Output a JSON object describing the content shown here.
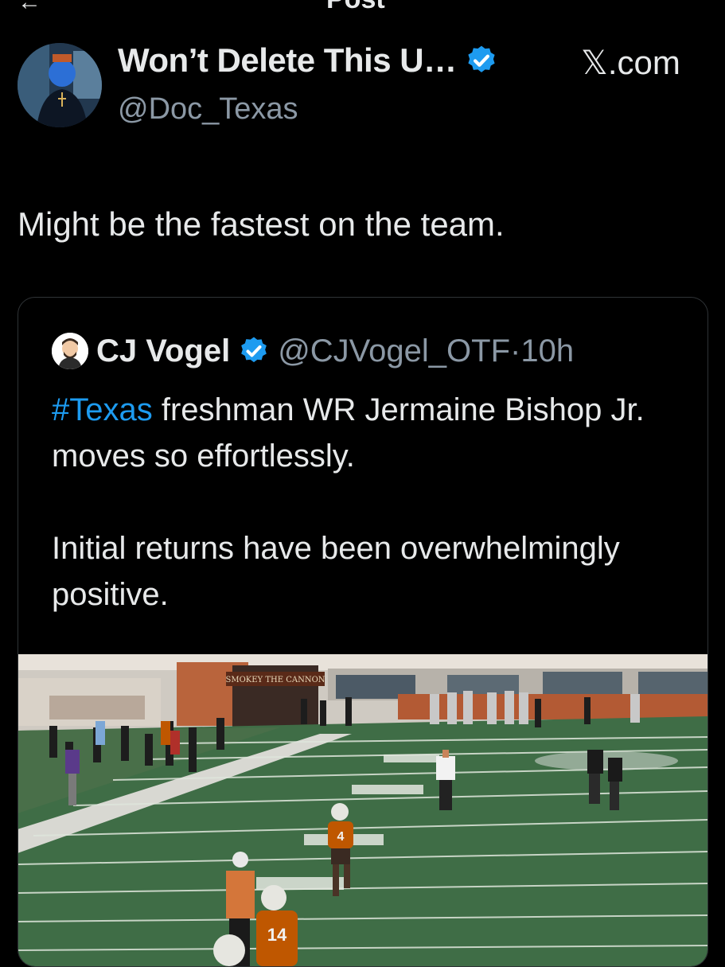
{
  "header": {
    "title": "Post",
    "back_icon": "arrow-left-icon"
  },
  "post": {
    "author": {
      "display_name": "Won’t Delete This U…",
      "handle": "@Doc_Texas",
      "verified": true
    },
    "source_label": "𝕏.com",
    "text": "Might be the fastest on the team."
  },
  "quoted_post": {
    "author": {
      "display_name": "CJ Vogel",
      "handle": "@CJVogel_OTF",
      "verified": true
    },
    "separator": "·",
    "time": "10h",
    "hashtag": "#Texas",
    "text_line1_rest": " freshman WR Jermaine Bishop Jr. moves so effortlessly.",
    "text_para2": "Initial returns have been overwhelmingly positive.",
    "media": {
      "banner_text": "SMOKEY THE CANNON",
      "jersey_numbers": [
        "4",
        "14"
      ]
    }
  },
  "colors": {
    "background": "#000000",
    "text": "#e7e9ea",
    "secondary": "#8b98a5",
    "link": "#1d9bf0",
    "verified": "#1d9bf0",
    "border": "#2f3336",
    "turf": "#3f6d46",
    "texas_orange": "#bf5700"
  }
}
